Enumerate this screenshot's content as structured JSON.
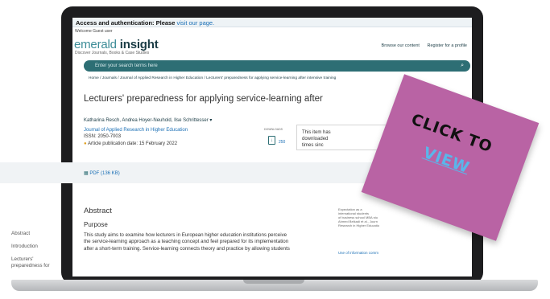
{
  "topbar": {
    "prefix": "Access and authentication: Please",
    "link": "visit our page."
  },
  "welcome": "Welcome Guest user",
  "brand": {
    "part1": "emerald",
    "part2": "insight",
    "tagline": "Discover Journals, Books & Case Studies"
  },
  "nav": {
    "browse": "Browse our content",
    "register": "Register for a profile"
  },
  "search": {
    "placeholder": "Enter your search terms here"
  },
  "breadcrumb": "Home / Journals / Journal of Applied Research in Higher Education / Lecturers' preparedness for applying service-learning after intensive training",
  "article": {
    "title": "Lecturers' preparedness for applying service-learning after",
    "authors": "Katharina Resch, Andrea Hoyer-Neuhold, Ilse Schrittesser",
    "journal": "Journal of Applied Research in Higher Education",
    "issn_label": "ISSN:",
    "issn": "2050-7003",
    "pub_label": "Article publication date:",
    "pub_date": "15 February 2022"
  },
  "downloads": {
    "label": "DOWNLOADS",
    "count": "250"
  },
  "infobox": {
    "line1": "This item has",
    "line2": "downloaded",
    "line3": "times sinc"
  },
  "pdf_label": "PDF (136 KB)",
  "sidebar": {
    "abstract": "Abstract",
    "introduction": "Introduction",
    "lecturers_1": "Lecturers'",
    "lecturers_2": "preparedness for"
  },
  "abstract": {
    "heading": "Abstract",
    "purpose": "Purpose",
    "line1": "This study aims to examine how lecturers in European higher education institutions perceive",
    "line2": "the service-learning approach as a teaching concept and feel prepared for its implementation",
    "line3": "after a short-term training. Service-learning connects theory and practice by allowing students"
  },
  "right_col": {
    "line1": "Expectation as a",
    "line2": "international students",
    "line3": "of business school MBA stu",
    "line4": "Ahmed Belkadi et al., Journ",
    "line5": "Research in Higher Educatio",
    "link": "Use of information comm"
  },
  "promo": {
    "click_to": "CLICK TO",
    "view": "VIEW"
  },
  "colors": {
    "teal": "#2d6e74",
    "link": "#1a6fb5",
    "promo_bg": "#b963a4",
    "promo_view": "#5ab6ea"
  }
}
